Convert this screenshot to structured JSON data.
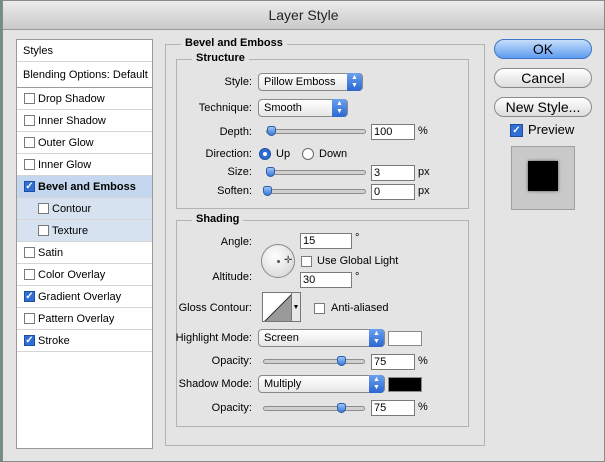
{
  "window": {
    "title": "Layer Style"
  },
  "sidebar": {
    "header": "Styles",
    "blending": "Blending Options: Default",
    "items": [
      {
        "label": "Drop Shadow",
        "checked": false
      },
      {
        "label": "Inner Shadow",
        "checked": false
      },
      {
        "label": "Outer Glow",
        "checked": false
      },
      {
        "label": "Inner Glow",
        "checked": false
      },
      {
        "label": "Bevel and Emboss",
        "checked": true,
        "selected": true
      },
      {
        "label": "Contour",
        "checked": false,
        "sub": true
      },
      {
        "label": "Texture",
        "checked": false,
        "sub": true
      },
      {
        "label": "Satin",
        "checked": false
      },
      {
        "label": "Color Overlay",
        "checked": false
      },
      {
        "label": "Gradient Overlay",
        "checked": true
      },
      {
        "label": "Pattern Overlay",
        "checked": false
      },
      {
        "label": "Stroke",
        "checked": true
      }
    ]
  },
  "bevel": {
    "title": "Bevel and Emboss",
    "structure": {
      "title": "Structure",
      "style_label": "Style:",
      "style_value": "Pillow Emboss",
      "technique_label": "Technique:",
      "technique_value": "Smooth",
      "depth_label": "Depth:",
      "depth_value": "100",
      "depth_unit": "%",
      "depth_slider": 0.04,
      "direction_label": "Direction:",
      "dir_up": "Up",
      "dir_down": "Down",
      "direction_selected": "Up",
      "size_label": "Size:",
      "size_value": "3",
      "size_unit": "px",
      "size_slider": 0.03,
      "soften_label": "Soften:",
      "soften_value": "0",
      "soften_unit": "px",
      "soften_slider": 0.0
    },
    "shading": {
      "title": "Shading",
      "angle_label": "Angle:",
      "angle_value": "15",
      "angle_unit": "°",
      "global_light_label": "Use Global Light",
      "global_light_checked": false,
      "altitude_label": "Altitude:",
      "altitude_value": "30",
      "altitude_unit": "°",
      "gloss_label": "Gloss Contour:",
      "anti_aliased_label": "Anti-aliased",
      "anti_aliased_checked": false,
      "highlight_label": "Highlight Mode:",
      "highlight_value": "Screen",
      "highlight_color": "#ffffff",
      "highlight_opacity_label": "Opacity:",
      "highlight_opacity": "75",
      "highlight_opacity_unit": "%",
      "highlight_slider": 0.75,
      "shadow_label": "Shadow Mode:",
      "shadow_value": "Multiply",
      "shadow_color": "#000000",
      "shadow_opacity_label": "Opacity:",
      "shadow_opacity": "75",
      "shadow_opacity_unit": "%",
      "shadow_slider": 0.75
    }
  },
  "buttons": {
    "ok": "OK",
    "cancel": "Cancel",
    "new_style": "New Style...",
    "preview_label": "Preview",
    "preview_checked": true
  },
  "colors": {
    "accent": "#2f6fd6",
    "selected_row": "#c5d7ee"
  }
}
